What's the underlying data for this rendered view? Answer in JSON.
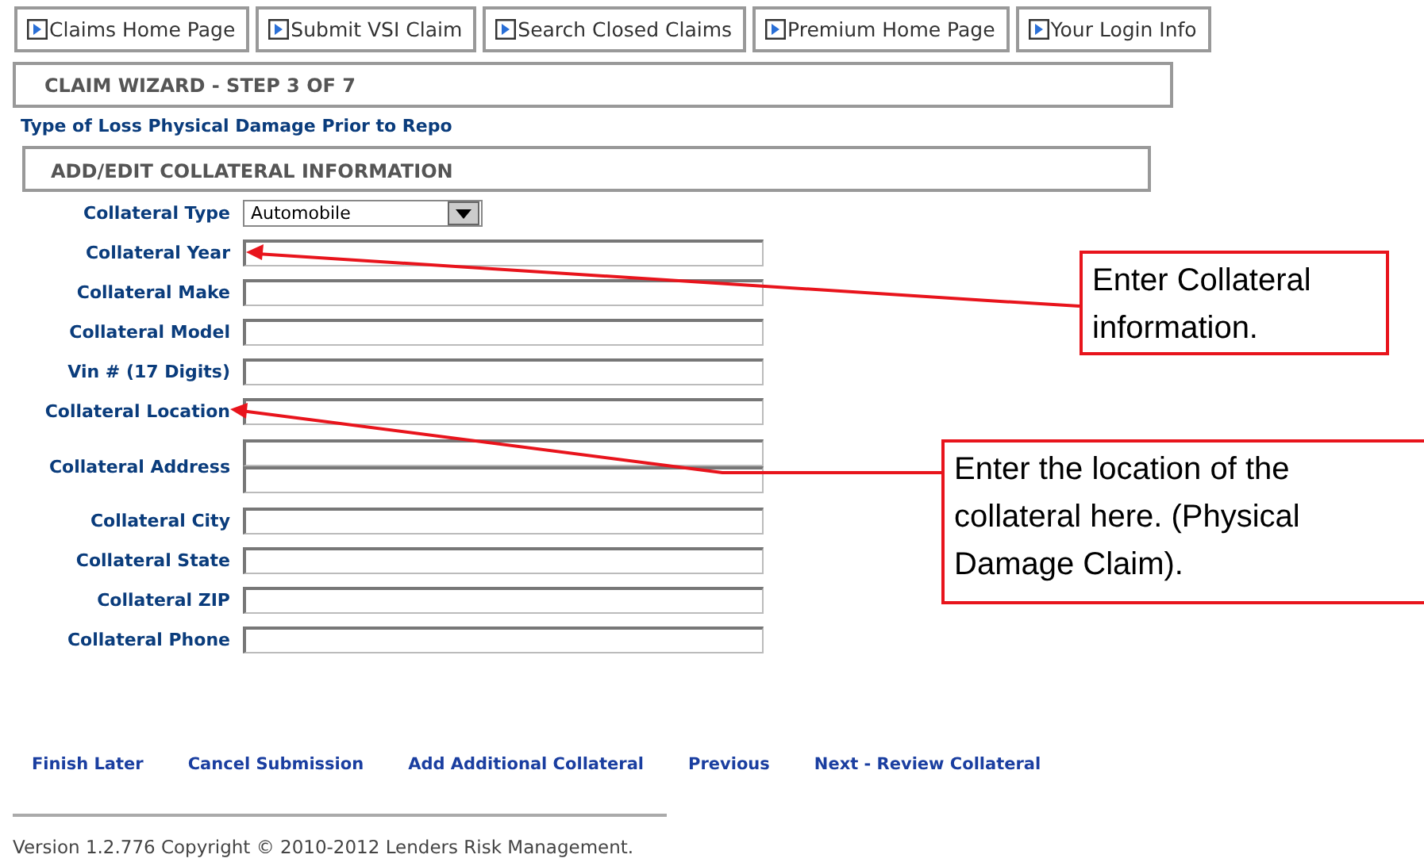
{
  "nav_links": [
    {
      "label": "Claims Home Page"
    },
    {
      "label": "Submit VSI Claim"
    },
    {
      "label": "Search Closed Claims"
    },
    {
      "label": "Premium Home Page"
    },
    {
      "label": "Your Login Info"
    }
  ],
  "wizard_title": "CLAIM WIZARD - STEP 3 OF 7",
  "loss_type": "Type of Loss Physical Damage Prior to Repo",
  "section_title": "ADD/EDIT COLLATERAL INFORMATION",
  "fields": [
    {
      "label": "Collateral Type",
      "kind": "select",
      "value": "Automobile"
    },
    {
      "label": "Collateral Year",
      "kind": "text"
    },
    {
      "label": "Collateral Make",
      "kind": "text"
    },
    {
      "label": "Collateral Model",
      "kind": "text"
    },
    {
      "label": "Vin # (17 Digits)",
      "kind": "text"
    },
    {
      "label": "Collateral Location",
      "kind": "text"
    },
    {
      "label": "Collateral Address",
      "kind": "multiline"
    },
    {
      "label": "Collateral City",
      "kind": "text"
    },
    {
      "label": "Collateral State",
      "kind": "text"
    },
    {
      "label": "Collateral ZIP",
      "kind": "text"
    },
    {
      "label": "Collateral Phone",
      "kind": "text"
    }
  ],
  "actions": [
    "Finish Later",
    "Cancel Submission",
    "Add Additional Collateral",
    "Previous",
    "Next - Review Collateral"
  ],
  "footer": "Version 1.2.776 Copyright © 2010-2012 Lenders Risk Management.",
  "callouts": [
    {
      "text": "Enter Collateral information."
    },
    {
      "text": "Enter the location of the collateral here. (Physical Damage Claim)."
    }
  ]
}
